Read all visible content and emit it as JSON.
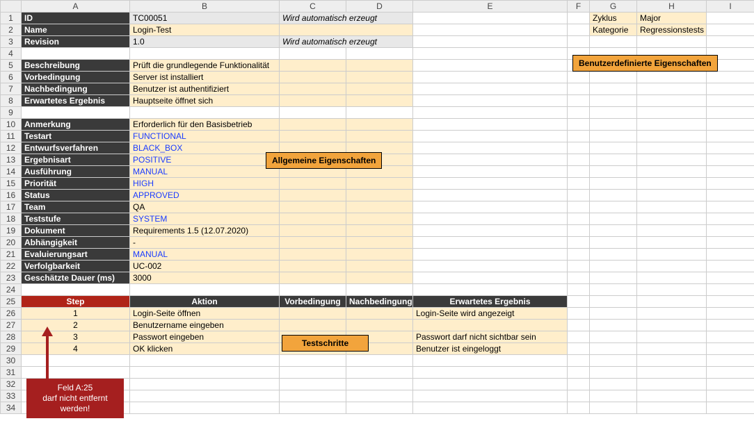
{
  "columns": [
    "A",
    "B",
    "C",
    "D",
    "E",
    "F",
    "G",
    "H",
    "I"
  ],
  "labels": {
    "id": "ID",
    "name": "Name",
    "revision": "Revision",
    "beschreibung": "Beschreibung",
    "vorbedingung": "Vorbedingung",
    "nachbedingung": "Nachbedingung",
    "erwartet": "Erwartetes Ergebnis",
    "anmerkung": "Anmerkung",
    "testart": "Testart",
    "entwurf": "Entwurfsverfahren",
    "ergebnisart": "Ergebnisart",
    "ausfuehrung": "Ausführung",
    "prioritaet": "Priorität",
    "status": "Status",
    "team": "Team",
    "teststufe": "Teststufe",
    "dokument": "Dokument",
    "abhaengigkeit": "Abhängigkeit",
    "evaluierung": "Evaluierungsart",
    "verfolgbarkeit": "Verfolgbarkeit",
    "dauer": "Geschätzte Dauer (ms)",
    "zyklus": "Zyklus",
    "kategorie": "Kategorie"
  },
  "values": {
    "id": "TC00051",
    "name": "Login-Test",
    "revision": "1.0",
    "auto": "Wird automatisch erzeugt",
    "beschreibung": "Prüft die grundlegende Funktionalität",
    "vorbedingung": "Server ist installiert",
    "nachbedingung": "Benutzer ist authentifiziert",
    "erwartet": "Hauptseite öffnet sich",
    "anmerkung": "Erforderlich für den Basisbetrieb",
    "testart": "FUNCTIONAL",
    "entwurf": "BLACK_BOX",
    "ergebnisart": "POSITIVE",
    "ausfuehrung": "MANUAL",
    "prioritaet": "HIGH",
    "status": "APPROVED",
    "team": "QA",
    "teststufe": "SYSTEM",
    "dokument": "Requirements 1.5 (12.07.2020)",
    "abhaengigkeit": "-",
    "evaluierung": "MANUAL",
    "verfolgbarkeit": "UC-002",
    "dauer": "3000",
    "zyklus": "Major",
    "kategorie": "Regressionstests"
  },
  "steps_header": {
    "step": "Step",
    "aktion": "Aktion",
    "vorbedingung": "Vorbedingung",
    "nachbedingung": "Nachbedingung",
    "erwartet": "Erwartetes Ergebnis"
  },
  "steps": [
    {
      "n": "1",
      "aktion": "Login-Seite öffnen",
      "vor": "",
      "nach": "",
      "erw": "Login-Seite wird angezeigt"
    },
    {
      "n": "2",
      "aktion": "Benutzername eingeben",
      "vor": "",
      "nach": "",
      "erw": ""
    },
    {
      "n": "3",
      "aktion": "Passwort eingeben",
      "vor": "",
      "nach": "",
      "erw": "Passwort darf nicht sichtbar sein"
    },
    {
      "n": "4",
      "aktion": "OK klicken",
      "vor": "",
      "nach": "",
      "erw": "Benutzer ist eingeloggt"
    }
  ],
  "callouts": {
    "allgemein": "Allgemeine Eigenschaften",
    "benutzerdef": "Benutzerdefinierte Eigenschaften",
    "testschritte": "Testschritte"
  },
  "warning": {
    "l1": "Feld A:25",
    "l2": "darf nicht entfernt",
    "l3": "werden!"
  }
}
